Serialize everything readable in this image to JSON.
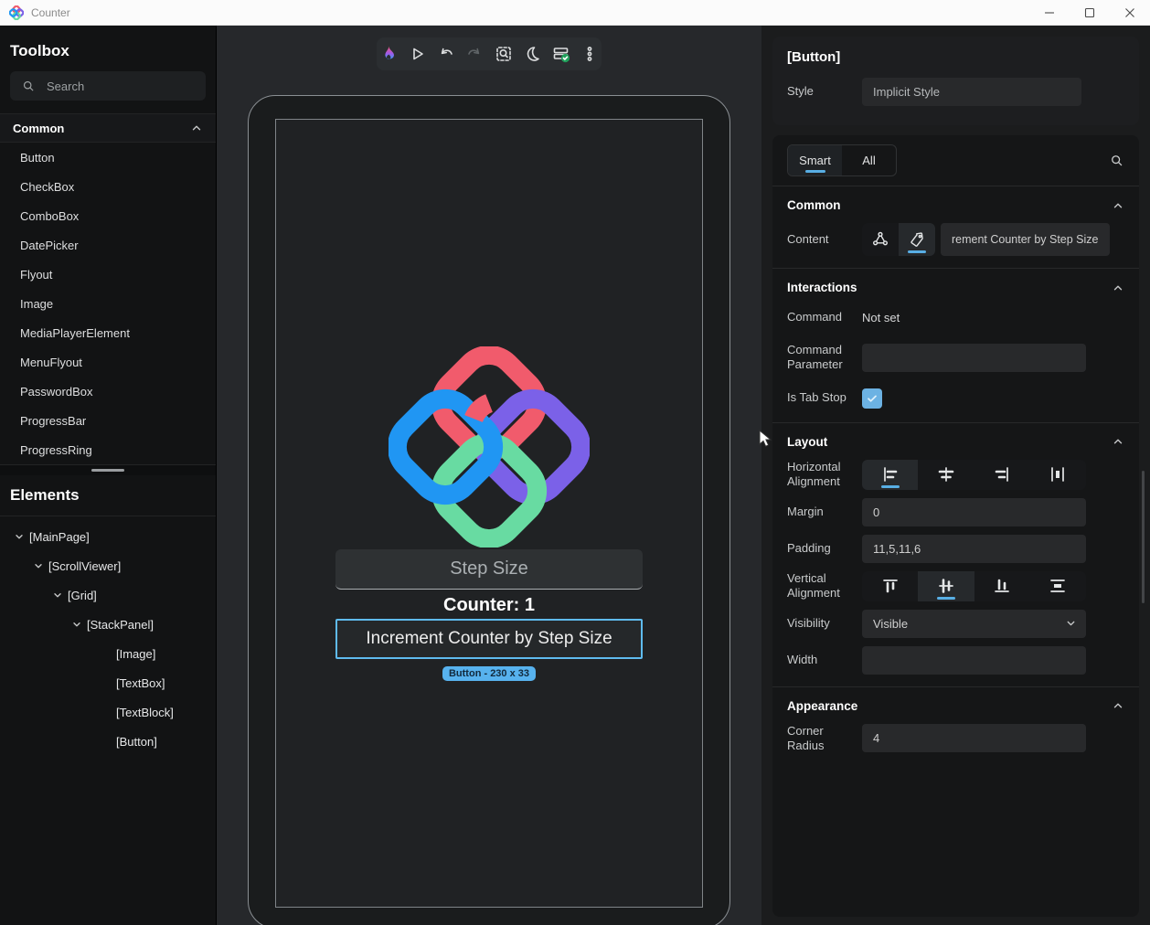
{
  "window": {
    "title": "Counter",
    "controls": [
      "minimize",
      "maximize",
      "close"
    ]
  },
  "toolbox": {
    "title": "Toolbox",
    "search_placeholder": "Search",
    "section_label": "Common",
    "items": [
      "Button",
      "CheckBox",
      "ComboBox",
      "DatePicker",
      "Flyout",
      "Image",
      "MediaPlayerElement",
      "MenuFlyout",
      "PasswordBox",
      "ProgressBar",
      "ProgressRing"
    ]
  },
  "elements": {
    "title": "Elements",
    "tree": [
      {
        "label": "[MainPage]"
      },
      {
        "label": "[ScrollViewer]"
      },
      {
        "label": "[Grid]"
      },
      {
        "label": "[StackPanel]"
      },
      {
        "label": "[Image]"
      },
      {
        "label": "[TextBox]"
      },
      {
        "label": "[TextBlock]"
      },
      {
        "label": "[Button]"
      }
    ]
  },
  "toolbar": {
    "icons": [
      "hot-design-flame",
      "play",
      "undo",
      "redo",
      "inspect",
      "theme-moon",
      "status-check",
      "more-menu"
    ]
  },
  "preview": {
    "textbox_placeholder": "Step Size",
    "counter_text": "Counter: 1",
    "button_label": "Increment Counter by Step Size",
    "selection_badge": "Button - 230 x 33"
  },
  "properties": {
    "header": {
      "title": "[Button]",
      "style_label": "Style",
      "style_value": "Implicit Style"
    },
    "tabs": {
      "smart": "Smart",
      "all": "All",
      "selected": "Smart"
    },
    "common": {
      "title": "Common",
      "content_label": "Content",
      "content_modes": [
        "binding",
        "literal"
      ],
      "content_mode_selected": "literal",
      "content_value": "rement Counter by Step Size"
    },
    "interactions": {
      "title": "Interactions",
      "command_label": "Command",
      "command_value": "Not set",
      "command_parameter_label": "Command Parameter",
      "command_parameter_value": "",
      "is_tab_stop_label": "Is Tab Stop",
      "is_tab_stop_checked": true
    },
    "layout": {
      "title": "Layout",
      "horizontal_alignment_label": "Horizontal Alignment",
      "horizontal_alignment_options": [
        "left",
        "center",
        "right",
        "stretch"
      ],
      "horizontal_alignment_selected": "left",
      "margin_label": "Margin",
      "margin_value": "0",
      "padding_label": "Padding",
      "padding_value": "11,5,11,6",
      "vertical_alignment_label": "Vertical Alignment",
      "vertical_alignment_options": [
        "top",
        "center",
        "bottom",
        "stretch"
      ],
      "vertical_alignment_selected": "center",
      "visibility_label": "Visibility",
      "visibility_value": "Visible",
      "width_label": "Width",
      "width_value": ""
    },
    "appearance": {
      "title": "Appearance",
      "corner_radius_label": "Corner Radius",
      "corner_radius_value": "4"
    }
  },
  "colors": {
    "accent": "#58AEE4",
    "badge": "#57B2EE",
    "sel-border": "#5FBBEF",
    "status-green": "#21A05B",
    "logo-red": "#F15B6C",
    "logo-blue": "#2096F3",
    "logo-purple": "#7B61E8",
    "logo-green": "#68DBA2"
  }
}
